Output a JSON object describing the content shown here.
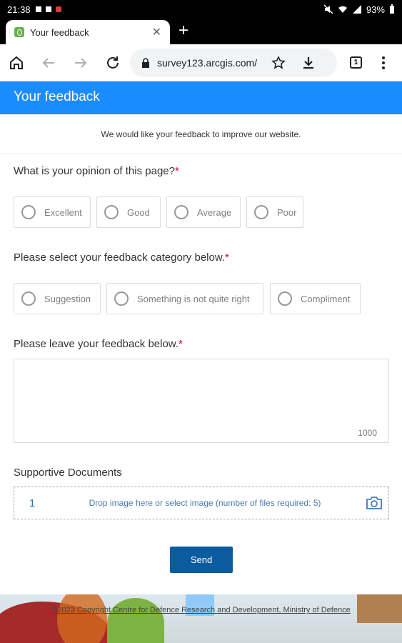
{
  "status_bar": {
    "time": "21:38",
    "battery": "93%"
  },
  "browser": {
    "tab_title": "Your feedback",
    "url": "survey123.arcgis.com/",
    "tab_count": "1"
  },
  "page": {
    "header_title": "Your feedback",
    "intro": "We would like your feedback to improve our website.",
    "q1": {
      "label": "What is your opinion of this page?",
      "options": [
        "Excellent",
        "Good",
        "Average",
        "Poor"
      ]
    },
    "q2": {
      "label": "Please select your feedback category below.",
      "options": [
        "Suggestion",
        "Something is not quite right",
        "Compliment"
      ]
    },
    "q3": {
      "label": "Please leave your feedback below.",
      "char_limit": "1000"
    },
    "q4": {
      "label": "Supportive Documents",
      "index": "1",
      "drop_text": "Drop image here or select image (number of files required: 5)"
    },
    "send_label": "Send",
    "footer_text": "©2023 Copyright Centre for Defence Research and Development, Ministry of Defence",
    "required_marker": "*"
  },
  "colors": {
    "header": "#1a8cff",
    "send": "#0c5b9f",
    "required": "#d0021b"
  }
}
